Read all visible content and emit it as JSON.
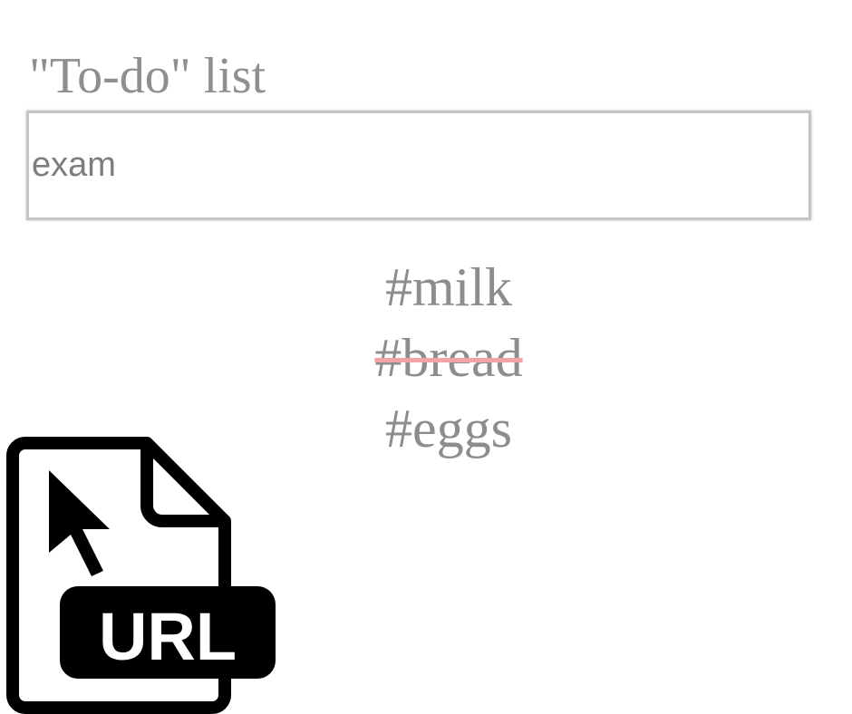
{
  "app": {
    "title": "\"To-do\" list"
  },
  "input": {
    "value": "exam",
    "placeholder": ""
  },
  "todos": [
    {
      "label": "#milk",
      "done": false
    },
    {
      "label": "#bread",
      "done": true
    },
    {
      "label": "#eggs",
      "done": false
    }
  ],
  "badge": {
    "icon": "url-file-icon",
    "text": "URL"
  },
  "colors": {
    "text_gray": "#8f8f8f",
    "strike": "#f2a3a3",
    "icon": "#000000"
  }
}
